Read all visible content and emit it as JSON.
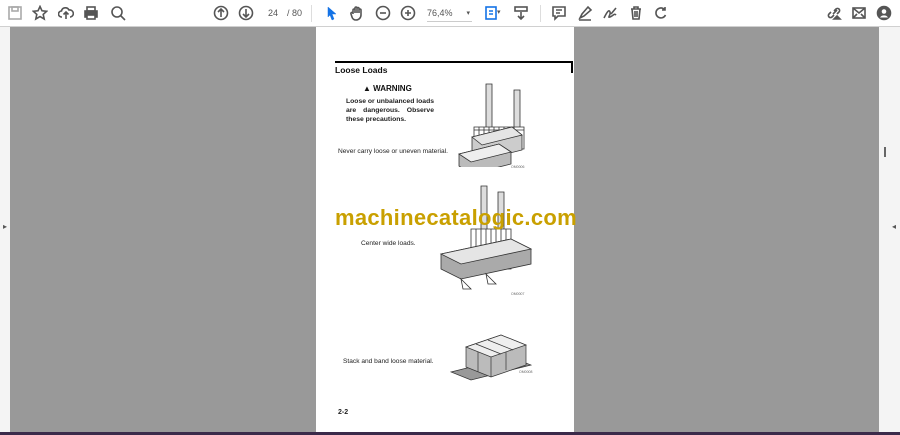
{
  "toolbar": {
    "page_current": "24",
    "page_total": "/ 80",
    "zoom": "76,4%",
    "accent": "#1473e6"
  },
  "document": {
    "title": "Loose Loads",
    "warning_label": "WARNING",
    "warning_text": "Loose or unbalanced loads are dangerous. Observe these precautions.",
    "captions": [
      "Never carry loose or uneven material.",
      "Center wide loads.",
      "Stack and band loose material."
    ],
    "figure_labels": [
      "OM0006",
      "OM0007",
      "OM0008"
    ],
    "page_footer": "2-2",
    "watermark": "machinecatalogic.com"
  }
}
